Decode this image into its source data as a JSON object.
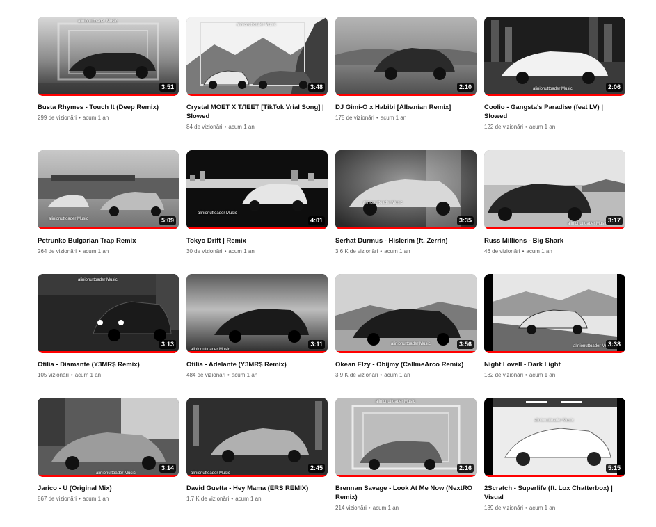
{
  "colors": {
    "progress": "#ff0000",
    "duration_bg": "#000000",
    "meta_text": "#606060"
  },
  "separator": "•",
  "videos": [
    {
      "title": "Busta Rhymes - Touch It (Deep Remix)",
      "views": "299 de vizionări",
      "age": "acum 1 an",
      "duration": "3:51",
      "watermark": "alinionuttoader Music"
    },
    {
      "title": "Crystal MOËT X ТЛЕЕТ [TikTok Vrial Song] | Slowed",
      "views": "84 de vizionări",
      "age": "acum 1 an",
      "duration": "3:48",
      "watermark": "alinionuttoader Music"
    },
    {
      "title": "DJ Gimi-O x Habibi [Albanian Remix]",
      "views": "175 de vizionări",
      "age": "acum 1 an",
      "duration": "2:10",
      "watermark": ""
    },
    {
      "title": "Coolio - Gangsta's Paradise (feat LV) | Slowed",
      "views": "122 de vizionări",
      "age": "acum 1 an",
      "duration": "2:06",
      "watermark": "alinionuttoader Music"
    },
    {
      "title": "Petrunko Bulgarian Trap Remix",
      "views": "264 de vizionări",
      "age": "acum 1 an",
      "duration": "5:09",
      "watermark": "alinionuttoader Music"
    },
    {
      "title": "Tokyo Drift | Remix",
      "views": "30 de vizionări",
      "age": "acum 1 an",
      "duration": "4:01",
      "watermark": "alinionuttoader Music"
    },
    {
      "title": "Serhat Durmus - Hislerim (ft. Zerrin)",
      "views": "3,6 K de vizionări",
      "age": "acum 1 an",
      "duration": "3:35",
      "watermark": "alinionuttoader Music"
    },
    {
      "title": "Russ Millions - Big Shark",
      "views": "46 de vizionări",
      "age": "acum 1 an",
      "duration": "3:17",
      "watermark": "alinionuttoader Music"
    },
    {
      "title": "Otilia - Diamante (Y3MR$ Remix)",
      "views": "105 vizionări",
      "age": "acum 1 an",
      "duration": "3:13",
      "watermark": "alinionuttoader Music"
    },
    {
      "title": "Otilia - Adelante (Y3MR$ Remix)",
      "views": "484 de vizionări",
      "age": "acum 1 an",
      "duration": "3:11",
      "watermark": "alinionuttoader Music"
    },
    {
      "title": "Okean Elzy - Obijmy (CallmeArco Remix)",
      "views": "3,9 K de vizionări",
      "age": "acum 1 an",
      "duration": "3:56",
      "watermark": "alinionuttoader Music"
    },
    {
      "title": "Night Lovell - Dark Light",
      "views": "182 de vizionări",
      "age": "acum 1 an",
      "duration": "3:38",
      "watermark": "alinionuttoader Music"
    },
    {
      "title": "Jarico - U (Original Mix)",
      "views": "867 de vizionări",
      "age": "acum 1 an",
      "duration": "3:14",
      "watermark": "alinionuttoader Music"
    },
    {
      "title": "David Guetta - Hey Mama (ERS REMIX)",
      "views": "1,7 K de vizionări",
      "age": "acum 1 an",
      "duration": "2:45",
      "watermark": "alinionuttoader Music"
    },
    {
      "title": "Brennan Savage - Look At Me Now (NextRO Remix)",
      "views": "214 vizionări",
      "age": "acum 1 an",
      "duration": "2:16",
      "watermark": "alinionuttoader Music"
    },
    {
      "title": "2Scratch - Superlife (ft. Lox Chatterbox) | Visual",
      "views": "139 de vizionări",
      "age": "acum 1 an",
      "duration": "5:15",
      "watermark": "alinionuttoader Music"
    }
  ]
}
